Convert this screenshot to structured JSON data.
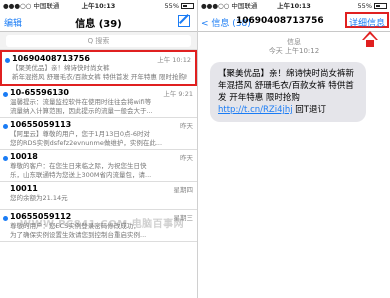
{
  "left": {
    "status": {
      "carrier": "●●●○○ 中国联通",
      "time": "上午10:13",
      "battery": "55%"
    },
    "nav": {
      "edit": "编辑",
      "title": "信息 (39)"
    },
    "search": {
      "placeholder": "Q 搜索"
    },
    "messages": [
      {
        "sender": "10690408713756",
        "time": "上午 10:12",
        "unread": true,
        "line1": "【聚美优品】亲！绵诗快时尚女裤",
        "line2": "新年混搭风 舒珊毛衣/百款女裤 特供首发 开年特惠 限时抢购h..."
      },
      {
        "sender": "10-65596130",
        "time": "上午 9:21",
        "unread": true,
        "line1": "温馨提示：流量监控软件在使用时往往会将wifi等",
        "line2": "流量纳入计算范围，因此提示的流量一般会大于..."
      },
      {
        "sender": "10655059113",
        "time": "昨天",
        "unread": true,
        "line1": "【阿里云】尊敬的用户，您于1月13日0点-6时对",
        "line2": "您的RDS实例dsfefz2evnunme做维护，实例在此..."
      },
      {
        "sender": "10018",
        "time": "昨天",
        "unread": true,
        "line1": "尊敬的客户：在您生日来临之际，为祝您生日快",
        "line2": "乐，山东联通特为您送上300M省内流量包，请..."
      },
      {
        "sender": "10011",
        "time": "星期四",
        "unread": false,
        "line1": "您的余额为21.14元",
        "line2": ""
      },
      {
        "sender": "10655059112",
        "time": "星期三",
        "unread": true,
        "line1": "尊敬的用户：您ECS实例登录密码修改成功，",
        "line2": "为了确保实例设置生效请您到控制台重启实例..."
      }
    ],
    "watermark": "WWW.PC841.COM 电脑百事网"
  },
  "right": {
    "status": {
      "carrier": "●●●○○ 中国联通",
      "time": "上午10:13",
      "battery": "55%"
    },
    "nav": {
      "back": "< 信息 (38)",
      "title": "10690408713756",
      "details": "详细信息"
    },
    "conv": {
      "label": "信息",
      "date": "今天 上午10:12"
    },
    "bubble": {
      "text": "【聚美优品】亲！绵诗快时尚女裤新年混搭风 舒珊毛衣/百款女裤 特供首发 开年特惠 限时抢购",
      "link": "http://t.cn/RZi4jhj",
      "suffix": " 回T退订"
    }
  },
  "colors": {
    "accent": "#1a7cf5",
    "highlight": "#e02020"
  }
}
